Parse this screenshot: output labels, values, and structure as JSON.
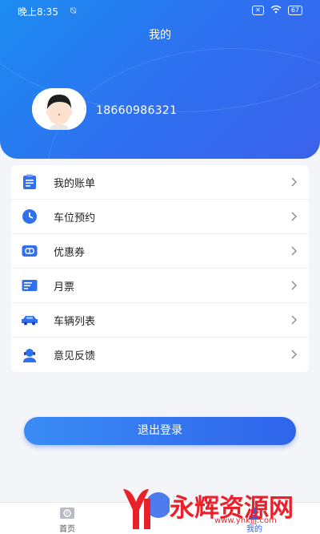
{
  "status_bar": {
    "time": "晚上8:35",
    "battery": "67"
  },
  "header": {
    "title": "我的",
    "phone": "18660986321"
  },
  "menu": {
    "items": [
      {
        "label": "我的账单",
        "icon": "bill-icon"
      },
      {
        "label": "车位预约",
        "icon": "clock-icon"
      },
      {
        "label": "优惠券",
        "icon": "coupon-icon"
      },
      {
        "label": "月票",
        "icon": "monthly-ticket-icon"
      },
      {
        "label": "车辆列表",
        "icon": "car-icon"
      },
      {
        "label": "意见反馈",
        "icon": "feedback-icon"
      }
    ]
  },
  "logout_label": "退出登录",
  "tabbar": {
    "tabs": [
      {
        "label": "首页",
        "icon": "home-icon"
      },
      {
        "label": "我的",
        "icon": "profile-icon"
      }
    ]
  },
  "watermark": {
    "text": "永辉资源网",
    "url": "www.yhkjjj.com"
  },
  "colors": {
    "primary": "#2f64ea",
    "header_start": "#1c8cf0",
    "watermark": "#e8212b"
  }
}
